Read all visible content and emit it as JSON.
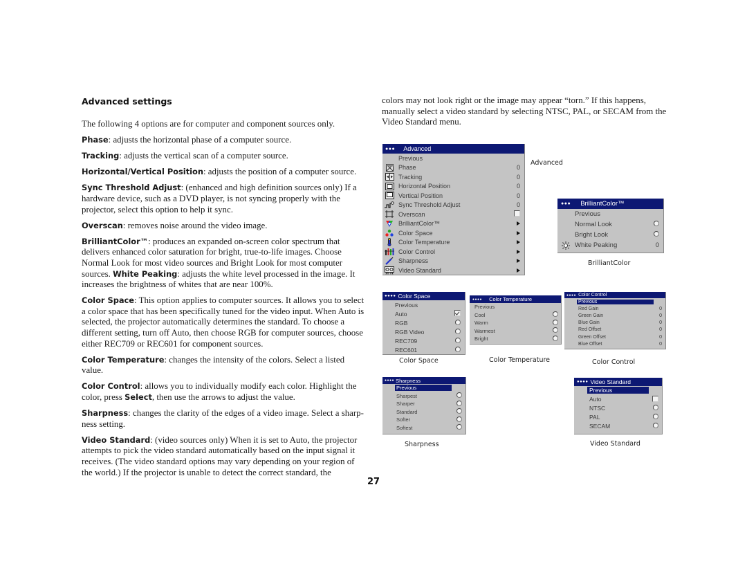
{
  "heading": "Advanced settings",
  "left_paragraphs": [
    {
      "bold": "",
      "text": "The following 4 options are for computer and component sources only."
    },
    {
      "bold": "Phase",
      "text": ": adjusts the horizontal phase of a computer source."
    },
    {
      "bold": "Tracking",
      "text": ": adjusts the vertical scan of a computer source."
    },
    {
      "bold": "Horizontal/Vertical Position",
      "text": ": adjusts the position of a computer source."
    },
    {
      "bold": "Sync Threshold Adjust",
      "text": ": (enhanced and high definition sources only) If a hardware device, such as a DVD player, is not syncing properly with the projector, select this option to help it sync."
    },
    {
      "bold": "Overscan",
      "text": ": removes noise around the video image."
    },
    {
      "bold": "BrilliantColor™",
      "text": ": produces an expanded on-screen color spectrum that delivers enhanced color saturation for bright, true-to-life images. Choose Normal Look for most video sources and Bright Look for most computer sources. ",
      "bold2": "White Peaking",
      "text2": ": adjusts the white level processed in the image. It increases the brightness of whites that are near 100%."
    },
    {
      "bold": "Color Space",
      "text": ": This option applies to computer sources. It allows you to select a color space that has been specifically tuned for the video input. When Auto is selected, the projector automatically determines the standard. To choose a different setting, turn off Auto, then choose RGB for computer sources, choose either REC709 or REC601 for component sources."
    },
    {
      "bold": "Color Temperature",
      "text": ": changes the intensity of the colors. Select a listed value."
    },
    {
      "bold": "Color Control",
      "text": ": allows you to individually modify each color. Highlight the color, press ",
      "bold2": "Select",
      "text2": ", then use the arrows to adjust the value."
    },
    {
      "bold": "Sharpness",
      "text": ": changes the clarity of the edges of a video image. Select a sharp-ness setting."
    },
    {
      "bold": "Video Standard",
      "text": ": (video sources only) When it is set to Auto, the projector attempts to pick the video standard automatically based on the input signal it receives. (The video standard options may vary depending on your region of the world.) If the projector is unable to detect the correct standard, the"
    }
  ],
  "right_paragraph": "colors may not look right or the image may appear “torn.” If this happens, manually select a video standard by selecting NTSC, PAL, or SECAM from the Video Standard menu.",
  "page_number": "27",
  "colors": {
    "menu_title_bg": "#0d1873",
    "menu_bg": "#c4c4c4"
  },
  "menus": {
    "advanced": {
      "dots": "●●●",
      "title": "Advanced",
      "caption": "Advanced",
      "items": [
        {
          "icon": "",
          "label": "Previous",
          "value": ""
        },
        {
          "icon": "phase-icon",
          "label": "Phase",
          "value": "0"
        },
        {
          "icon": "tracking-icon",
          "label": "Tracking",
          "value": "0"
        },
        {
          "icon": "horizontal-position-icon",
          "label": "Horizontal Position",
          "value": "0"
        },
        {
          "icon": "vertical-position-icon",
          "label": "Vertical Position",
          "value": "0"
        },
        {
          "icon": "sync-threshold-icon",
          "label": "Sync Threshold Adjust",
          "value": "0"
        },
        {
          "icon": "overscan-icon",
          "label": "Overscan",
          "value": "checkbox-off"
        },
        {
          "icon": "brilliantcolor-icon",
          "label": "BrilliantColor™",
          "value": "submenu-arrow"
        },
        {
          "icon": "color-space-icon",
          "label": "Color Space",
          "value": "submenu-arrow"
        },
        {
          "icon": "color-temperature-icon",
          "label": "Color Temperature",
          "value": "submenu-arrow"
        },
        {
          "icon": "color-control-icon",
          "label": "Color Control",
          "value": "submenu-arrow"
        },
        {
          "icon": "sharpness-icon",
          "label": "Sharpness",
          "value": "submenu-arrow"
        },
        {
          "icon": "video-standard-icon",
          "label": "Video Standard",
          "value": "submenu-arrow"
        }
      ]
    },
    "brilliantcolor": {
      "dots": "●●●",
      "title": "BrilliantColor™",
      "caption": "BrilliantColor",
      "items": [
        {
          "icon": "",
          "label": "Previous",
          "value": ""
        },
        {
          "icon": "",
          "label": "Normal Look",
          "value": "radio"
        },
        {
          "icon": "",
          "label": "Bright Look",
          "value": "radio"
        },
        {
          "icon": "white-peaking-icon",
          "label": "White Peaking",
          "value": "0"
        }
      ]
    },
    "color_space": {
      "dots": "●●●●",
      "title": "Color Space",
      "caption": "Color Space",
      "items": [
        {
          "label": "Previous",
          "value": ""
        },
        {
          "label": "Auto",
          "value": "checkbox-on"
        },
        {
          "label": "RGB",
          "value": "radio"
        },
        {
          "label": "RGB Video",
          "value": "radio"
        },
        {
          "label": "REC709",
          "value": "radio"
        },
        {
          "label": "REC601",
          "value": "radio"
        }
      ]
    },
    "color_temperature": {
      "dots": "●●●●",
      "title": "Color Temperature",
      "caption": "Color Temperature",
      "items": [
        {
          "label": "Previous",
          "value": ""
        },
        {
          "label": "Cool",
          "value": "radio"
        },
        {
          "label": "Warm",
          "value": "radio"
        },
        {
          "label": "Warmest",
          "value": "radio"
        },
        {
          "label": "Bright",
          "value": "radio"
        }
      ]
    },
    "color_control": {
      "dots": "●●●●",
      "title": "Color Control",
      "caption": "Color Control",
      "items": [
        {
          "label": "Previous",
          "value": "",
          "selected": true
        },
        {
          "label": "Red Gain",
          "value": "0"
        },
        {
          "label": "Green Gain",
          "value": "0"
        },
        {
          "label": "Blue Gain",
          "value": "0"
        },
        {
          "label": "Red Offset",
          "value": "0"
        },
        {
          "label": "Green Offset",
          "value": "0"
        },
        {
          "label": "Blue Offset",
          "value": "0"
        }
      ]
    },
    "sharpness": {
      "dots": "●●●●",
      "title": "Sharpness",
      "caption": "Sharpness",
      "items": [
        {
          "label": "Previous",
          "value": "",
          "selected": true
        },
        {
          "label": "Sharpest",
          "value": "radio"
        },
        {
          "label": "Sharper",
          "value": "radio"
        },
        {
          "label": "Standard",
          "value": "radio"
        },
        {
          "label": "Softer",
          "value": "radio"
        },
        {
          "label": "Softest",
          "value": "radio"
        }
      ]
    },
    "video_standard": {
      "dots": "●●●●",
      "title": "Video Standard",
      "caption": "Video Standard",
      "items": [
        {
          "label": "Previous",
          "value": "",
          "selected": true
        },
        {
          "label": "Auto",
          "value": "checkbox-off"
        },
        {
          "label": "NTSC",
          "value": "radio"
        },
        {
          "label": "PAL",
          "value": "radio"
        },
        {
          "label": "SECAM",
          "value": "radio"
        }
      ]
    }
  }
}
